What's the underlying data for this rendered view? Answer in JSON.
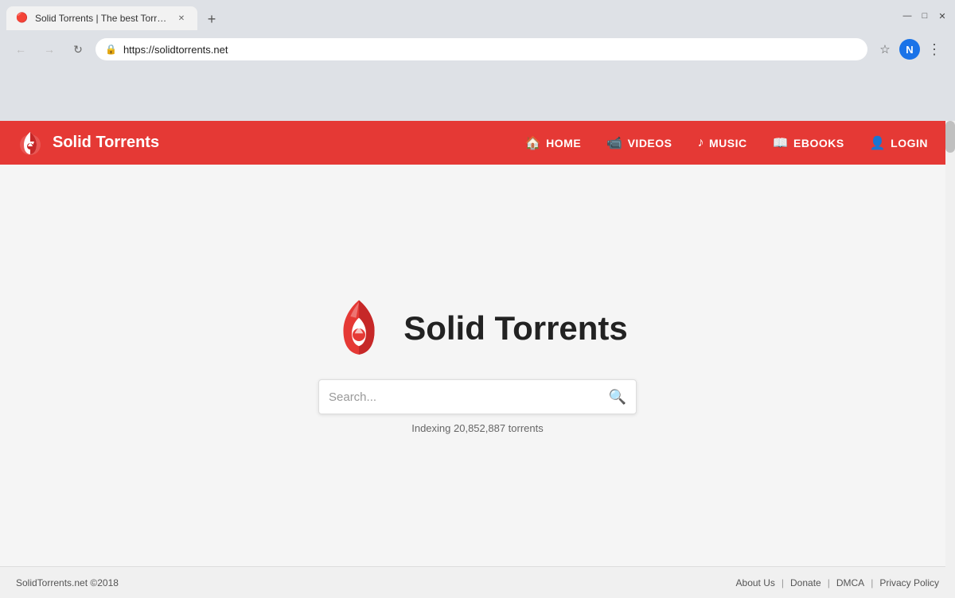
{
  "browser": {
    "tab_title": "Solid Torrents | The best Torrent",
    "tab_favicon": "🔴",
    "url": "https://solidtorrents.net",
    "new_tab_label": "+",
    "nav": {
      "back_label": "←",
      "forward_label": "→",
      "reload_label": "↻",
      "lock_icon": "🔒"
    },
    "toolbar": {
      "star_label": "☆",
      "user_initial": "N",
      "more_label": "⋮"
    },
    "window_controls": {
      "minimize": "—",
      "maximize": "□",
      "close": "✕"
    }
  },
  "site": {
    "navbar": {
      "logo_alt": "Solid Torrents Logo",
      "title": "Solid Torrents",
      "links": [
        {
          "id": "home",
          "label": "HOME",
          "icon": "🏠"
        },
        {
          "id": "videos",
          "label": "VIDEOS",
          "icon": "📹"
        },
        {
          "id": "music",
          "label": "MUSIC",
          "icon": "🎵"
        },
        {
          "id": "ebooks",
          "label": "EBOOKS",
          "icon": "📖"
        },
        {
          "id": "login",
          "label": "LOGIN",
          "icon": "👤"
        }
      ]
    },
    "hero": {
      "title": "Solid Torrents",
      "search_placeholder": "Search...",
      "indexing_text": "Indexing 20,852,887 torrents"
    },
    "footer": {
      "copyright": "SolidTorrents.net ©2018",
      "links": [
        {
          "id": "about",
          "label": "About Us"
        },
        {
          "id": "donate",
          "label": "Donate"
        },
        {
          "id": "dmca",
          "label": "DMCA"
        },
        {
          "id": "privacy",
          "label": "Privacy Policy"
        }
      ],
      "separators": [
        "|",
        "|",
        "|"
      ]
    }
  },
  "colors": {
    "navbar_bg": "#e53935",
    "hero_bg": "#f5f5f5",
    "logo_red": "#e53935",
    "user_avatar_bg": "#1a73e8"
  }
}
